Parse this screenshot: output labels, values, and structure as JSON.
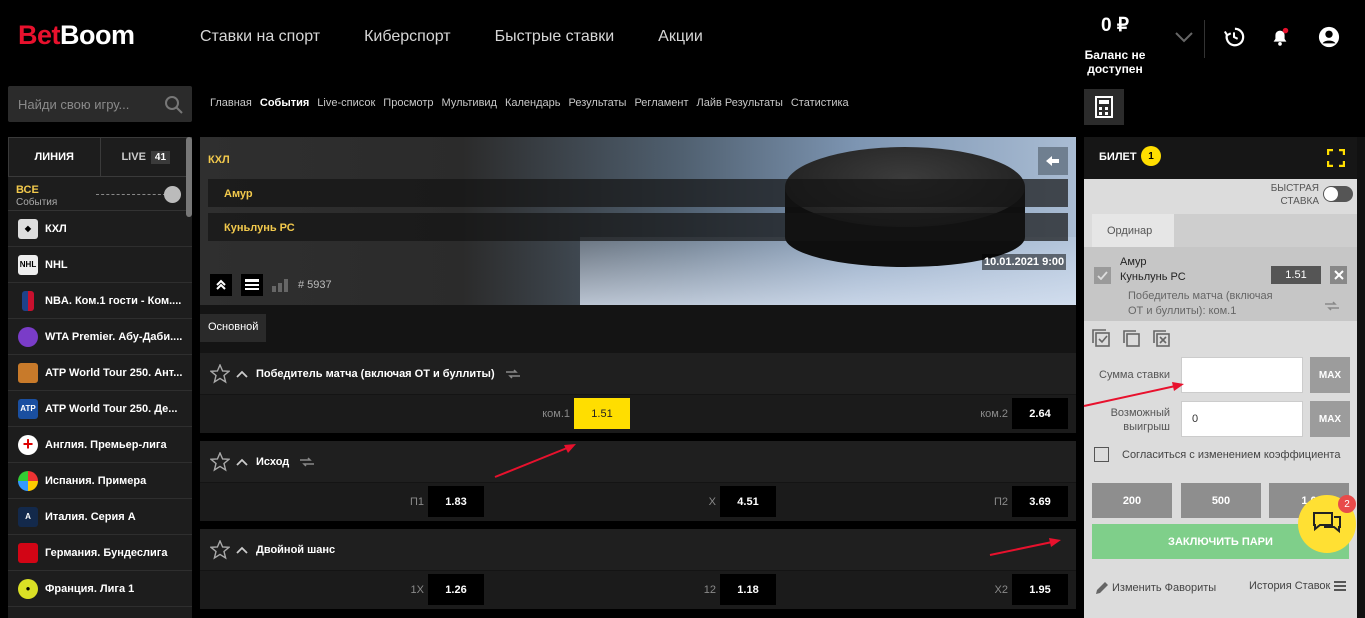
{
  "brand": {
    "logo_part1": "Bet",
    "logo_part2": "Boom",
    "accent": "#e8112d",
    "highlight": "#ffde00"
  },
  "nav": [
    "Ставки на спорт",
    "Киберспорт",
    "Быстрые ставки",
    "Акции"
  ],
  "balance": {
    "amount": "0 ₽",
    "status": "Баланс не доступен"
  },
  "search": {
    "placeholder": "Найди свою игру..."
  },
  "breadcrumbs": [
    "Главная",
    "События",
    "Live-список",
    "Просмотр",
    "Мультивид",
    "Календарь",
    "Результаты",
    "Регламент",
    "Лайв Результаты",
    "Статистика"
  ],
  "sidebar": {
    "tab_line": "ЛИНИЯ",
    "tab_live": "LIVE",
    "live_count": "41",
    "all_label": "ВСЕ",
    "all_sub": "События",
    "items": [
      {
        "label": "КХЛ",
        "icon": "khl-icon"
      },
      {
        "label": "NHL",
        "icon": "nhl-icon"
      },
      {
        "label": "NBA. Ком.1 гости - Ком....",
        "icon": "nba-icon"
      },
      {
        "label": "WTA Premier. Абу-Даби....",
        "icon": "wta-icon"
      },
      {
        "label": "ATP World Tour 250. Ант...",
        "icon": "atp-cup-icon"
      },
      {
        "label": "ATP World Tour 250. Де...",
        "icon": "atp-icon"
      },
      {
        "label": "Англия. Премьер-лига",
        "icon": "england-flag-icon"
      },
      {
        "label": "Испания. Примера",
        "icon": "laliga-icon"
      },
      {
        "label": "Италия. Серия А",
        "icon": "seriea-icon"
      },
      {
        "label": "Германия. Бундеслига",
        "icon": "bundesliga-icon"
      },
      {
        "label": "Франция. Лига 1",
        "icon": "ligue1-icon"
      }
    ]
  },
  "event": {
    "league": "КХЛ",
    "team1": "Амур",
    "team2": "Куньлунь РС",
    "datetime": "10.01.2021  9:00",
    "event_id": "# 5937",
    "tab": "Основной"
  },
  "markets": [
    {
      "title": "Победитель матча (включая ОТ и буллиты)",
      "outcomes": [
        {
          "label": "ком.1",
          "odd": "1.51",
          "selected": true
        },
        {
          "label": "ком.2",
          "odd": "2.64"
        }
      ]
    },
    {
      "title": "Исход",
      "outcomes": [
        {
          "label": "П1",
          "odd": "1.83"
        },
        {
          "label": "X",
          "odd": "4.51"
        },
        {
          "label": "П2",
          "odd": "3.69"
        }
      ]
    },
    {
      "title": "Двойной шанс",
      "outcomes": [
        {
          "label": "1X",
          "odd": "1.26"
        },
        {
          "label": "12",
          "odd": "1.18"
        },
        {
          "label": "X2",
          "odd": "1.95"
        }
      ]
    }
  ],
  "ticket": {
    "title": "БИЛЕТ",
    "count": "1",
    "fast_bet_line1": "БЫСТРАЯ",
    "fast_bet_line2": "СТАВКА",
    "tab": "Ординар",
    "bet_team1": "Амур",
    "bet_team2": "Куньлунь РС",
    "bet_odd": "1.51",
    "bet_desc_line1": "Победитель матча (включая",
    "bet_desc_line2": "ОТ и буллиты): ком.1",
    "stake_label": "Сумма ставки",
    "stake_value": "",
    "win_label_line1": "Возможный",
    "win_label_line2": "выигрыш",
    "win_value": "0",
    "max_label": "MAX",
    "agree_label": "Согласиться с изменением коэффициента",
    "quick_amounts": [
      "200",
      "500",
      "1 0"
    ],
    "place_bet": "ЗАКЛЮЧИТЬ ПАРИ",
    "edit_favorites": "Изменить Фавориты",
    "bet_history": "История Ставок"
  },
  "chat": {
    "badge": "2"
  }
}
